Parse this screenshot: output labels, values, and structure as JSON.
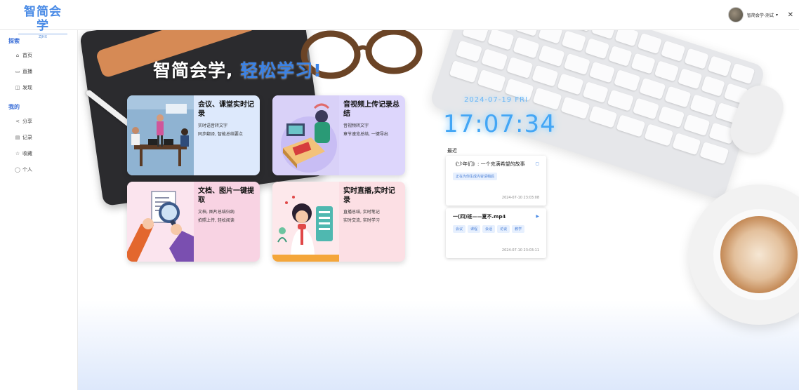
{
  "header": {
    "logo_title": "智简会学",
    "logo_sub": "ZJHX",
    "username": "智简会学-测试",
    "caret": "▾",
    "fullscreen_icon": "✕"
  },
  "sidebar": {
    "groups": [
      {
        "title": "探索",
        "items": [
          {
            "label": "首页",
            "icon": "⌂"
          },
          {
            "label": "直播",
            "icon": "▭"
          },
          {
            "label": "发现",
            "icon": "◫"
          }
        ]
      },
      {
        "title": "我的",
        "items": [
          {
            "label": "分享",
            "icon": "<"
          },
          {
            "label": "记录",
            "icon": "▤"
          },
          {
            "label": "收藏",
            "icon": "☆"
          },
          {
            "label": "个人",
            "icon": "◯"
          }
        ]
      }
    ]
  },
  "hero": {
    "text": "智简会学,",
    "accent": "轻松学习!"
  },
  "cards": [
    {
      "title": "会议、课堂实时记录",
      "desc1": "实时语音转文字",
      "desc2": "同步翻译, 智能总结要点"
    },
    {
      "title": "音视频上传记录总结",
      "desc1": "音视频转文字",
      "desc2": "章节速览总结, 一键导出"
    },
    {
      "title": "文档、图片一键提取",
      "desc1": "文档, 图片总结归纳",
      "desc2": "拍照上传, 轻松阅读"
    },
    {
      "title": "实时直播,实时记录",
      "desc1": "直播总结, 实时笔记",
      "desc2": "实时交流, 实时学习"
    }
  ],
  "clock": {
    "date": "2024-07-19 FRI",
    "time": "17:07:34"
  },
  "recent": {
    "label": "最近",
    "items": [
      {
        "title": "《少年们》: 一个充满希望的故事",
        "tags": [
          "正在为你生成内容请稍后"
        ],
        "time": "2024-07-10 23:03:08",
        "icon": "▢"
      },
      {
        "title": "一(四)班——夏不.mp4",
        "tags": [
          "会议",
          "课程",
          "会话",
          "访谈",
          "教学"
        ],
        "time": "2024-07-10 23:03:11",
        "icon": "▶"
      }
    ]
  },
  "colors": {
    "accent": "#3a82e6",
    "clock": "#43a6f5"
  }
}
